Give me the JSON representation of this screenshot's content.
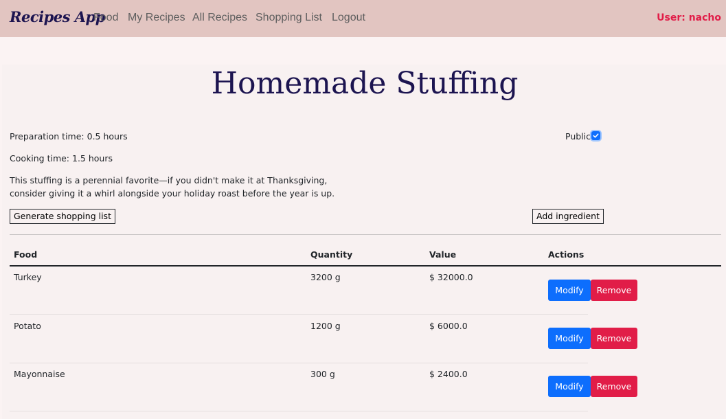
{
  "nav": {
    "brand": "Recipes App",
    "links": [
      "Food",
      "My Recipes",
      "All Recipes",
      "Shopping List",
      "Logout"
    ],
    "user_label": "User: nacho"
  },
  "recipe": {
    "title": "Homemade Stuffing",
    "prep_time": "Preparation time: 0.5 hours",
    "cook_time": "Cooking time: 1.5 hours",
    "description": "This stuffing is a perennial favorite—if you didn't make it at Thanksgiving, consider giving it a whirl alongside your holiday roast before the year is up.",
    "public_label": "Public",
    "public_checked": true
  },
  "buttons": {
    "generate": "Generate shopping list",
    "add_ingredient": "Add ingredient",
    "modify": "Modify",
    "remove": "Remove"
  },
  "table": {
    "headers": [
      "Food",
      "Quantity",
      "Value",
      "Actions"
    ],
    "rows": [
      {
        "food": "Turkey",
        "quantity": "3200 g",
        "value": "$ 32000.0"
      },
      {
        "food": "Potato",
        "quantity": "1200 g",
        "value": "$ 6000.0"
      },
      {
        "food": "Mayonnaise",
        "quantity": "300 g",
        "value": "$ 2400.0"
      }
    ]
  },
  "colors": {
    "navbar": "#e2c5c1",
    "title": "#1c1450",
    "primary": "#0d6efd",
    "danger": "#e11d48"
  }
}
